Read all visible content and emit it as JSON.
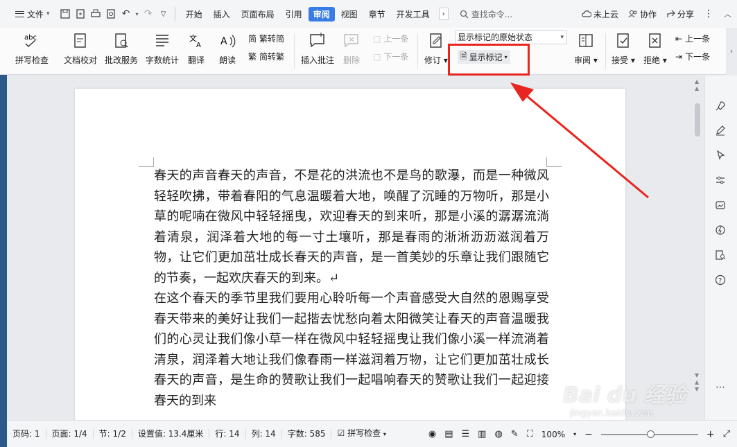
{
  "menubar": {
    "file_label": "文件",
    "tabs": [
      "开始",
      "插入",
      "页面布局",
      "引用",
      "审阅",
      "视图",
      "章节",
      "开发工具"
    ],
    "active_tab": "审阅",
    "search_placeholder": "查找命令...",
    "cloud_label": "未上云",
    "collab_label": "协作",
    "share_label": "分享"
  },
  "ribbon": {
    "spell_check": "拼写检查",
    "doc_compare": "文档校对",
    "review_service": "批改服务",
    "word_count": "字数统计",
    "translate": "翻译",
    "read_aloud": "朗读",
    "trad_to_simp": "繁转简",
    "simp_to_trad": "简转繁",
    "insert_comment": "插入批注",
    "delete": "删除",
    "prev_item": "上一条",
    "next_item": "下一条",
    "revise": "修订",
    "markup_state": "显示标记的原始状态",
    "show_markup": "显示标记",
    "review_pane": "审阅",
    "accept": "接受",
    "reject": "拒绝",
    "prev_change": "上一条",
    "next_change": "下一条"
  },
  "document": {
    "paragraphs": [
      "春天的声音春天的声音，不是花的洪流也不是鸟的歌瀑，而是一种微风轻轻吹拂，带着春阳的气息温暖着大地，唤醒了沉睡的万物听，那是小草的呢喃在微风中轻轻摇曳，欢迎春天的到来听，那是小溪的潺潺流淌着清泉，润泽着大地的每一寸土壤听，那是春雨的淅淅沥沥滋润着万物，让它们更加茁壮成长春天的声音，是一首美妙的乐章让我们跟随它的节奏，一起欢庆春天的到来。↵",
      "在这个春天的季节里我们要用心聆听每一个声音感受大自然的恩赐享受春天带来的美好让我们一起揩去忧愁向着太阳微笑让春天的声音温暖我们的心灵让我们像小草一样在微风中轻轻摇曳让我们像小溪一样流淌着清泉，润泽着大地让我们像春雨一样滋润着万物，让它们更加茁壮成长春天的声音，是生命的赞歌让我们一起唱响春天的赞歌让我们一起迎接春天的到来"
    ]
  },
  "statusbar": {
    "page_num": "页码: 1",
    "pages": "页面: 1/4",
    "section": "节: 1/2",
    "setting": "设置值: 13.4厘米",
    "row": "行: 14",
    "col": "列: 14",
    "word_count": "字数: 585",
    "spell_check": "拼写检查",
    "zoom": "100%"
  },
  "watermark": {
    "brand": "Bai du 经验",
    "url": "jingyan.baidu.com"
  },
  "colors": {
    "active_tab": "#3a7ce6",
    "highlight_box": "#e8251e",
    "arrow": "#e8251e"
  }
}
